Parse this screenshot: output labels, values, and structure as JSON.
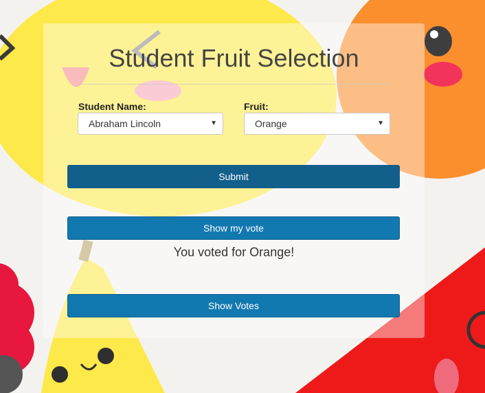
{
  "page": {
    "title": "Student Fruit Selection"
  },
  "form": {
    "student_label": "Student Name:",
    "student_value": "Abraham Lincoln",
    "fruit_label": "Fruit:",
    "fruit_value": "Orange",
    "caret": "▼"
  },
  "buttons": {
    "submit": "Submit",
    "show_my_vote": "Show my vote",
    "show_votes": "Show Votes"
  },
  "vote_message": "You voted for Orange!",
  "colors": {
    "submit_button": "#135f8b",
    "primary_button": "#1278b0",
    "title_text": "#444444"
  }
}
